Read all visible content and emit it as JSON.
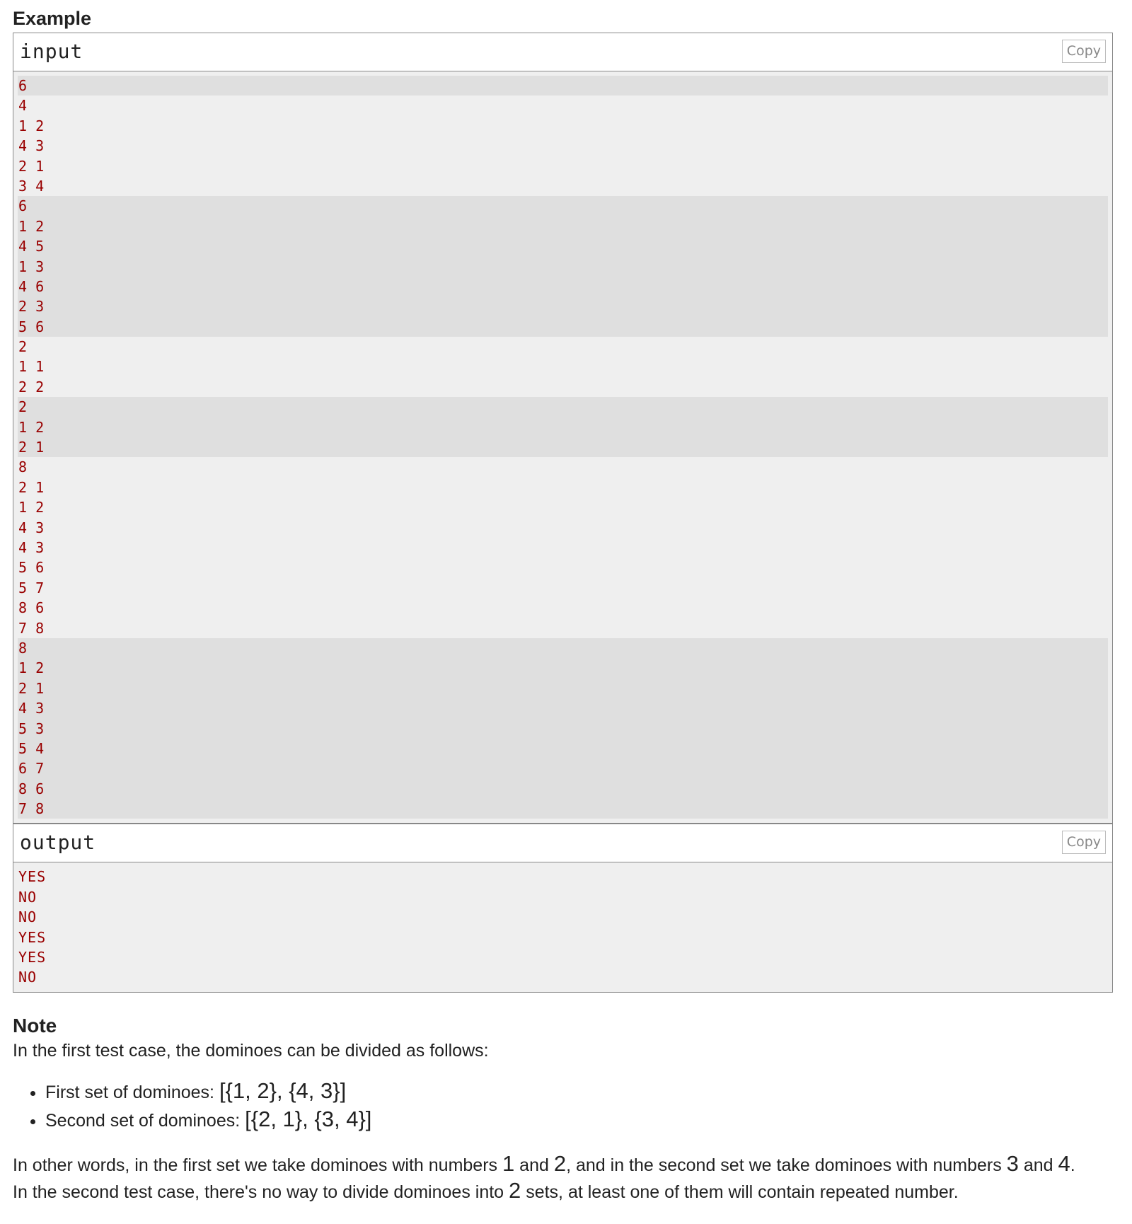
{
  "example": {
    "title": "Example",
    "input": {
      "label": "input",
      "copy_label": "Copy",
      "groups": [
        {
          "highlight": true,
          "lines": [
            "6"
          ]
        },
        {
          "highlight": false,
          "lines": [
            "4",
            "1 2",
            "4 3",
            "2 1",
            "3 4"
          ]
        },
        {
          "highlight": true,
          "lines": [
            "6",
            "1 2",
            "4 5",
            "1 3",
            "4 6",
            "2 3",
            "5 6"
          ]
        },
        {
          "highlight": false,
          "lines": [
            "2",
            "1 1",
            "2 2"
          ]
        },
        {
          "highlight": true,
          "lines": [
            "2",
            "1 2",
            "2 1"
          ]
        },
        {
          "highlight": false,
          "lines": [
            "8",
            "2 1",
            "1 2",
            "4 3",
            "4 3",
            "5 6",
            "5 7",
            "8 6",
            "7 8"
          ]
        },
        {
          "highlight": true,
          "lines": [
            "8",
            "1 2",
            "2 1",
            "4 3",
            "5 3",
            "5 4",
            "6 7",
            "8 6",
            "7 8"
          ]
        }
      ]
    },
    "output": {
      "label": "output",
      "copy_label": "Copy",
      "lines": [
        "YES",
        "NO",
        "NO",
        "YES",
        "YES",
        "NO"
      ]
    }
  },
  "note": {
    "title": "Note",
    "intro": "In the first test case, the dominoes can be divided as follows:",
    "sets": [
      {
        "label": "First set of dominoes: ",
        "math": "[{1, 2}, {4, 3}]"
      },
      {
        "label": "Second set of dominoes: ",
        "math": "[{2, 1}, {3, 4}]"
      }
    ],
    "paragraph1": {
      "t1": "In other words, in the first set we take dominoes with numbers ",
      "m1": "1",
      "t2": " and ",
      "m2": "2",
      "t3": ", and in the second set we take dominoes with numbers ",
      "m3": "3",
      "t4": " and ",
      "m4": "4",
      "t5": "."
    },
    "paragraph2": {
      "t1": "In the second test case, there's no way to divide dominoes into ",
      "m1": "2",
      "t2": " sets, at least one of them will contain repeated number."
    }
  },
  "colors": {
    "sample_text": "#990000",
    "highlight_row": "#dfdfdf",
    "sample_bg": "#efefef",
    "border": "#888888"
  }
}
